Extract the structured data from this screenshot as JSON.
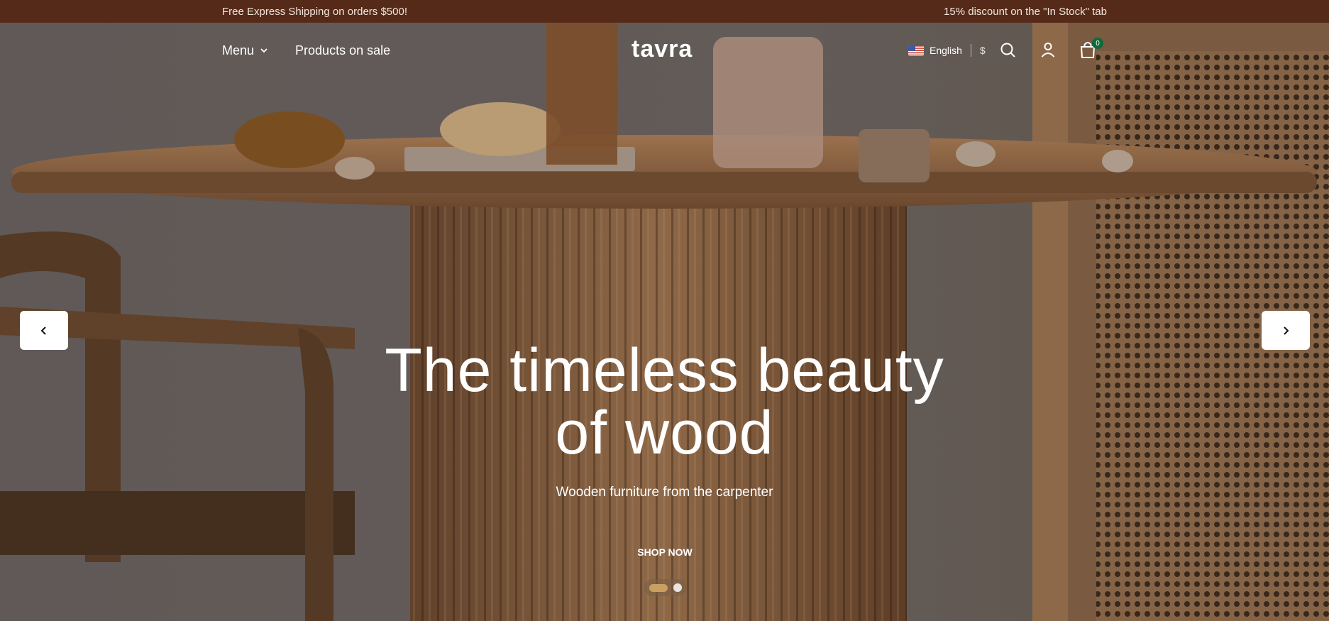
{
  "announcement": {
    "left_text": "Free Express Shipping on orders $500!",
    "right_text": "15% discount on the \"In Stock\" tab"
  },
  "nav": {
    "menu_label": "Menu",
    "sale_label": "Products on sale",
    "logo_text": "tavra",
    "language_label": "English",
    "currency_label": "$",
    "cart_count": "0"
  },
  "icons": {
    "menu_chevron": "chevron-down-icon",
    "flag": "us-flag-icon",
    "search": "search-icon",
    "account": "user-icon",
    "cart": "shopping-bag-icon",
    "prev": "chevron-left-icon",
    "next": "chevron-right-icon"
  },
  "hero": {
    "headline_line1": "The timeless beauty",
    "headline_line2": "of wood",
    "subtitle": "Wooden furniture from the carpenter",
    "cta_label": "SHOP NOW",
    "slide_count": 2,
    "active_slide": 1
  },
  "colors": {
    "announcement_bg": "#552a18",
    "cart_badge": "#0f6a3a",
    "active_dot": "#c9a060"
  }
}
